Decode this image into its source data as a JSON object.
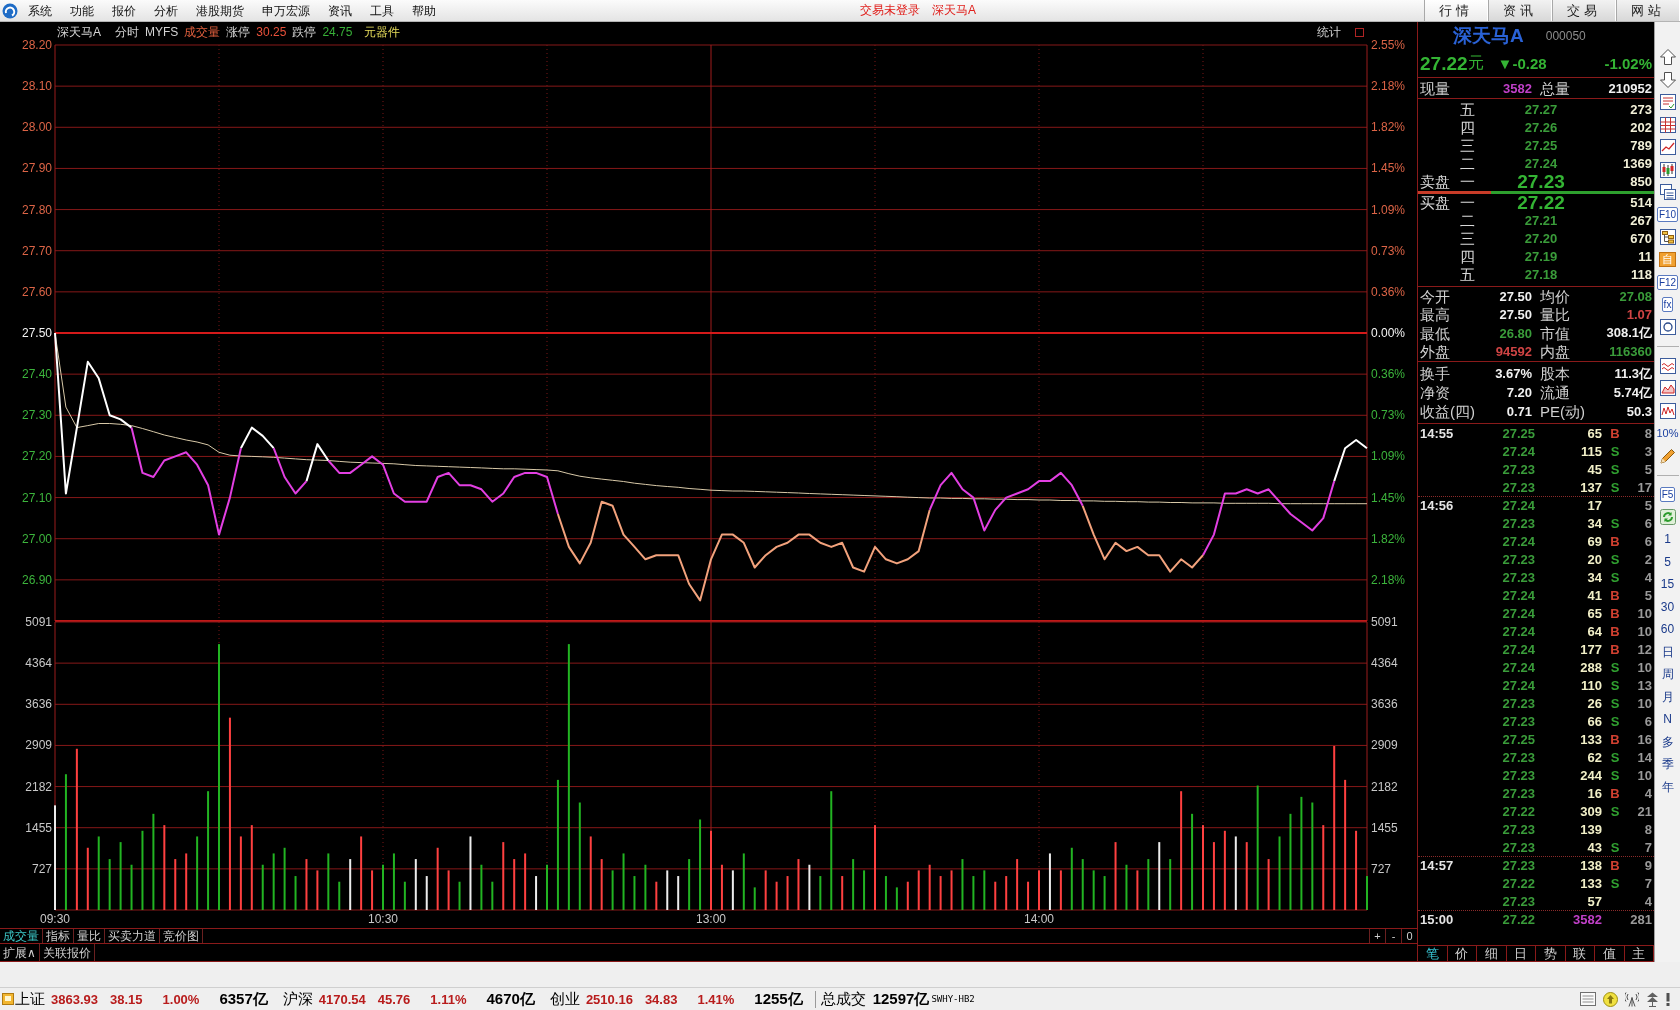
{
  "menu_bar": {
    "items": [
      "系统",
      "功能",
      "报价",
      "分析",
      "港股期货",
      "申万宏源",
      "资讯",
      "工具",
      "帮助"
    ],
    "login_status": "交易未登录",
    "stock_name": "深天马A",
    "tabs": [
      {
        "label": "行情",
        "selected": true
      },
      {
        "label": "资讯",
        "selected": false
      },
      {
        "label": "交易",
        "selected": false
      },
      {
        "label": "网站",
        "selected": false
      }
    ]
  },
  "chart_header": {
    "stock_name": "深天马A",
    "mode": "分时",
    "indicator": "MYFS",
    "volume_label": "成交量",
    "limit_up_label": "涨停",
    "limit_up": "30.25",
    "limit_down_label": "跌停",
    "limit_down": "24.75",
    "industry": "元器件",
    "stats_button": "统计"
  },
  "price_chart": {
    "chart_data": {
      "type": "line",
      "grid": true,
      "categories": [
        null,
        null,
        null,
        null,
        null,
        null,
        null,
        null,
        null,
        null,
        null,
        null,
        null,
        null,
        null,
        null,
        null,
        null,
        null,
        null,
        null,
        null,
        null,
        null,
        null,
        null,
        null,
        null,
        null,
        null,
        null,
        null,
        null,
        null,
        null,
        null,
        null,
        null,
        null,
        null,
        null,
        null,
        null,
        null,
        null,
        null,
        null,
        null,
        null,
        null,
        null,
        null,
        null,
        null,
        null,
        null,
        null,
        null,
        null,
        null,
        null,
        null,
        null,
        null,
        null,
        null,
        null,
        null,
        null,
        null,
        null,
        null,
        null,
        null,
        null,
        null,
        null,
        null,
        null,
        null,
        null,
        null,
        null,
        null,
        null,
        null,
        null,
        null,
        null,
        null,
        null,
        null,
        null,
        null,
        null,
        null,
        null,
        null,
        null,
        null,
        null,
        null,
        null,
        null,
        null,
        null,
        null,
        null,
        null,
        null,
        null,
        null,
        null,
        null,
        null,
        null,
        null,
        null,
        null,
        null,
        null
      ],
      "ylim": [
        26.8,
        28.2
      ],
      "yticks": [
        {
          "value": 28.2,
          "label": "28.20"
        },
        {
          "value": 28.1,
          "label": "28.10"
        },
        {
          "value": 28.0,
          "label": "28.00"
        },
        {
          "value": 27.9,
          "label": "27.90"
        },
        {
          "value": 27.8,
          "label": "27.80"
        },
        {
          "value": 27.7,
          "label": "27.70"
        },
        {
          "value": 27.6,
          "label": "27.60"
        },
        {
          "value": 27.5,
          "label": "27.50"
        },
        {
          "value": 27.4,
          "label": "27.40"
        },
        {
          "value": 27.3,
          "label": "27.30"
        },
        {
          "value": 27.2,
          "label": "27.20"
        },
        {
          "value": 27.1,
          "label": "27.10"
        },
        {
          "value": 27.0,
          "label": "27.00"
        },
        {
          "value": 26.9,
          "label": "26.90"
        }
      ],
      "series": [
        {
          "color": "#d8c9a8",
          "values": [
            27.5,
            27.32,
            27.27,
            27.275,
            27.28,
            27.28,
            27.278,
            27.275,
            27.268,
            27.26,
            27.252,
            27.246,
            27.24,
            27.235,
            27.228,
            27.21,
            27.203,
            27.201,
            27.2,
            27.199,
            27.198,
            27.196,
            27.194,
            27.192,
            27.191,
            27.19,
            27.188,
            27.186,
            27.185,
            27.184,
            27.183,
            27.182,
            27.18,
            27.178,
            27.177,
            27.176,
            27.175,
            27.174,
            27.173,
            27.172,
            27.171,
            27.17,
            27.17,
            27.169,
            27.168,
            27.167,
            27.165,
            27.158,
            27.152,
            27.148,
            27.145,
            27.142,
            27.139,
            27.135,
            27.132,
            27.129,
            27.127,
            27.125,
            27.122,
            27.12,
            27.118,
            27.117,
            27.116,
            27.116,
            27.115,
            27.114,
            27.113,
            27.112,
            27.111,
            27.11,
            27.109,
            27.108,
            27.107,
            27.106,
            27.105,
            27.104,
            27.103,
            27.102,
            27.101,
            27.1,
            27.099,
            27.099,
            27.098,
            27.098,
            27.097,
            27.097,
            27.096,
            27.096,
            27.095,
            27.095,
            27.094,
            27.094,
            27.093,
            27.093,
            27.092,
            27.092,
            27.091,
            27.091,
            27.09,
            27.09,
            27.089,
            27.089,
            27.088,
            27.088,
            27.087,
            27.087,
            27.087,
            27.086,
            27.086,
            27.086,
            27.086,
            27.086,
            27.085,
            27.085,
            27.085,
            27.085,
            27.085,
            27.085,
            27.085,
            27.085,
            27.085
          ]
        },
        {
          "color": "#d41a1a",
          "values": [
            27.5,
            27.5,
            27.5,
            27.5,
            27.5,
            27.5,
            27.5,
            27.5,
            27.5,
            27.5,
            27.5,
            27.5,
            27.5,
            27.5,
            27.5,
            27.5,
            27.5,
            27.5,
            27.5,
            27.5,
            27.5,
            27.5,
            27.5,
            27.5,
            27.5,
            27.5,
            27.5,
            27.5,
            27.5,
            27.5,
            27.5,
            27.5,
            27.5,
            27.5,
            27.5,
            27.5,
            27.5,
            27.5,
            27.5,
            27.5,
            27.5,
            27.5,
            27.5,
            27.5,
            27.5,
            27.5,
            27.5,
            27.5,
            27.5,
            27.5,
            27.5,
            27.5,
            27.5,
            27.5,
            27.5,
            27.5,
            27.5,
            27.5,
            27.5,
            27.5,
            27.5,
            27.5,
            27.5,
            27.5,
            27.5,
            27.5,
            27.5,
            27.5,
            27.5,
            27.5,
            27.5,
            27.5,
            27.5,
            27.5,
            27.5,
            27.5,
            27.5,
            27.5,
            27.5,
            27.5,
            27.5,
            27.5,
            27.5,
            27.5,
            27.5,
            27.5,
            27.5,
            27.5,
            27.5,
            27.5,
            27.5,
            27.5,
            27.5,
            27.5,
            27.5,
            27.5,
            27.5,
            27.5,
            27.5,
            27.5,
            27.5,
            27.5,
            27.5,
            27.5,
            27.5,
            27.5,
            27.5,
            27.5,
            27.5,
            27.5,
            27.5,
            27.5,
            27.5,
            27.5,
            27.5,
            27.5,
            27.5,
            27.5,
            27.5,
            27.5,
            27.5
          ]
        },
        {
          "color": "#ffffff",
          "values": [
            27.5,
            27.11,
            27.27,
            27.43,
            27.39,
            27.3,
            27.29,
            27.27,
            null,
            null,
            null,
            null,
            null,
            null,
            null,
            null,
            null,
            27.22,
            27.27,
            27.25,
            27.22,
            null,
            null,
            27.14,
            27.23,
            27.19,
            null,
            null,
            null,
            null,
            null,
            null,
            null,
            null,
            null,
            null,
            null,
            null,
            null,
            null,
            null,
            null,
            null,
            null,
            null,
            null,
            null,
            null,
            null,
            null,
            null,
            null,
            null,
            null,
            null,
            null,
            null,
            null,
            null,
            null,
            null,
            null,
            null,
            null,
            null,
            null,
            null,
            null,
            null,
            null,
            null,
            null,
            null,
            null,
            null,
            null,
            null,
            null,
            null,
            null,
            null,
            null,
            null,
            null,
            null,
            null,
            null,
            null,
            null,
            null,
            null,
            null,
            null,
            null,
            null,
            null,
            null,
            null,
            null,
            null,
            null,
            null,
            null,
            null,
            null,
            null,
            null,
            null,
            null,
            null,
            null,
            null,
            null,
            null,
            null,
            null,
            null,
            27.14,
            27.22,
            27.24,
            27.22
          ]
        },
        {
          "color": "#e23fe2",
          "values": [
            null,
            null,
            null,
            null,
            null,
            null,
            null,
            27.27,
            27.16,
            27.15,
            27.19,
            27.2,
            27.21,
            27.18,
            27.13,
            27.01,
            27.1,
            27.22,
            null,
            null,
            27.22,
            27.15,
            27.11,
            27.14,
            null,
            27.19,
            27.16,
            27.16,
            27.18,
            27.2,
            27.18,
            27.11,
            27.09,
            27.09,
            27.09,
            27.15,
            27.16,
            27.13,
            27.13,
            27.12,
            27.09,
            27.11,
            27.15,
            27.16,
            27.16,
            27.15,
            27.06,
            null,
            null,
            null,
            null,
            null,
            null,
            null,
            null,
            null,
            null,
            null,
            null,
            null,
            null,
            null,
            null,
            null,
            null,
            null,
            null,
            null,
            null,
            null,
            null,
            null,
            null,
            null,
            null,
            null,
            null,
            null,
            null,
            null,
            27.07,
            27.13,
            27.16,
            27.12,
            27.1,
            27.02,
            27.07,
            27.1,
            27.11,
            27.12,
            27.14,
            27.14,
            27.16,
            27.13,
            27.08,
            null,
            null,
            null,
            null,
            null,
            null,
            null,
            null,
            null,
            null,
            26.96,
            27.01,
            27.11,
            27.11,
            27.12,
            27.11,
            27.12,
            27.09,
            27.06,
            27.04,
            27.02,
            27.05,
            27.14,
            null,
            null,
            null
          ]
        },
        {
          "color": "#f2a27c",
          "values": [
            null,
            null,
            null,
            null,
            null,
            null,
            null,
            null,
            null,
            null,
            null,
            null,
            null,
            null,
            null,
            null,
            null,
            null,
            null,
            null,
            null,
            null,
            null,
            null,
            null,
            null,
            null,
            null,
            null,
            null,
            null,
            null,
            null,
            null,
            null,
            null,
            null,
            null,
            null,
            null,
            null,
            null,
            null,
            null,
            null,
            null,
            27.06,
            26.98,
            26.94,
            26.99,
            27.09,
            27.08,
            27.01,
            26.98,
            26.95,
            26.96,
            26.96,
            26.96,
            26.89,
            26.85,
            26.95,
            27.01,
            27.01,
            26.99,
            26.93,
            26.96,
            26.98,
            26.99,
            27.01,
            27.01,
            26.99,
            26.98,
            26.99,
            26.93,
            26.92,
            26.98,
            26.95,
            26.94,
            26.95,
            26.97,
            27.07,
            null,
            null,
            null,
            null,
            null,
            null,
            null,
            null,
            null,
            null,
            null,
            null,
            null,
            27.08,
            27.01,
            26.95,
            26.99,
            26.97,
            26.98,
            26.96,
            26.96,
            26.92,
            26.95,
            26.93,
            26.96,
            null,
            null,
            null,
            null,
            null,
            null,
            null,
            null,
            null,
            null,
            null,
            null,
            null,
            null,
            null
          ]
        }
      ]
    },
    "right_labels": [
      "2.55%",
      "2.18%",
      "1.82%",
      "1.45%",
      "1.09%",
      "0.73%",
      "0.36%",
      "0.00%",
      "0.36%",
      "0.73%",
      "1.09%",
      "1.45%",
      "1.82%",
      "2.18%"
    ]
  },
  "volume_chart": {
    "chart_data": {
      "type": "bar",
      "grid": true,
      "categories": [
        "09:30",
        null,
        null,
        null,
        null,
        null,
        null,
        null,
        null,
        null,
        null,
        null,
        null,
        null,
        null,
        null,
        null,
        null,
        null,
        null,
        null,
        null,
        null,
        null,
        null,
        null,
        null,
        null,
        null,
        null,
        "10:30",
        null,
        null,
        null,
        null,
        null,
        null,
        null,
        null,
        null,
        null,
        null,
        null,
        null,
        null,
        null,
        null,
        null,
        null,
        null,
        null,
        null,
        null,
        null,
        null,
        null,
        null,
        null,
        null,
        null,
        "13:00",
        null,
        null,
        null,
        null,
        null,
        null,
        null,
        null,
        null,
        null,
        null,
        null,
        null,
        null,
        null,
        null,
        null,
        null,
        null,
        null,
        null,
        null,
        null,
        null,
        null,
        null,
        null,
        null,
        null,
        "14:00",
        null,
        null,
        null,
        null,
        null,
        null,
        null,
        null,
        null,
        null,
        null,
        null,
        null,
        null,
        null,
        null,
        null,
        null,
        null,
        null,
        null,
        null,
        null,
        null,
        null,
        null,
        null,
        null,
        null,
        null
      ],
      "ylim": [
        0,
        5091
      ],
      "yticks": [
        5091,
        4364,
        3636,
        2909,
        2182,
        1455,
        727
      ],
      "series": [
        {
          "values": [
            1850,
            2400,
            2850,
            1100,
            1300,
            900,
            1200,
            800,
            1400,
            1700,
            1500,
            900,
            1000,
            1300,
            2100,
            4700,
            3400,
            1300,
            1500,
            800,
            1000,
            1100,
            600,
            900,
            700,
            1000,
            500,
            900,
            1300,
            700,
            800,
            1000,
            500,
            900,
            600,
            1100,
            700,
            500,
            1300,
            800,
            500,
            1200,
            900,
            1000,
            600,
            800,
            2300,
            4700,
            1900,
            1300,
            900,
            700,
            1000,
            600,
            800,
            500,
            700,
            600,
            900,
            1600,
            1400,
            800,
            700,
            1000,
            400,
            700,
            500,
            600,
            900,
            800,
            600,
            2100,
            600,
            900,
            700,
            1500,
            600,
            400,
            500,
            700,
            800,
            600,
            700,
            900,
            600,
            700,
            500,
            600,
            900,
            500,
            700,
            1000,
            700,
            1100,
            900,
            700,
            600,
            1200,
            800,
            700,
            900,
            1200,
            900,
            2100,
            1700,
            1500,
            1200,
            1400,
            1300,
            1200,
            2200,
            900,
            1300,
            1700,
            2000,
            1900,
            1500,
            2900,
            2300,
            1400,
            600
          ]
        }
      ]
    },
    "right_labels": [
      "5091",
      "4364",
      "3636",
      "2909",
      "2182",
      "1455",
      "727"
    ]
  },
  "chart_tabs": [
    {
      "label": "成交量",
      "selected": true
    },
    {
      "label": "指标",
      "selected": false
    },
    {
      "label": "量比",
      "selected": false
    },
    {
      "label": "买卖力道",
      "selected": false
    },
    {
      "label": "竞价图",
      "selected": false
    }
  ],
  "zoom_controls": [
    "+",
    "-",
    "0"
  ],
  "extra_tabs": [
    "扩展∧",
    "关联报价"
  ],
  "quote_panel": {
    "name": "深天马A",
    "code": "000050",
    "price": "27.22",
    "unit": "元",
    "change": "▼-0.28",
    "percent": "-1.02%",
    "current_volume_label": "现量",
    "current_volume": "3582",
    "total_volume_label": "总量",
    "total_volume": "210952",
    "asks_label": "卖盘",
    "asks": [
      {
        "rank": "五",
        "price": "27.27",
        "volume": "273"
      },
      {
        "rank": "四",
        "price": "27.26",
        "volume": "202"
      },
      {
        "rank": "三",
        "price": "27.25",
        "volume": "789"
      },
      {
        "rank": "二",
        "price": "27.24",
        "volume": "1369"
      },
      {
        "rank": "一",
        "price": "27.23",
        "volume": "850"
      }
    ],
    "order_balance": {
      "level": 0.31
    },
    "bids_label": "买盘",
    "bids": [
      {
        "rank": "一",
        "price": "27.22",
        "volume": "514"
      },
      {
        "rank": "二",
        "price": "27.21",
        "volume": "267"
      },
      {
        "rank": "三",
        "price": "27.20",
        "volume": "670"
      },
      {
        "rank": "四",
        "price": "27.19",
        "volume": "11"
      },
      {
        "rank": "五",
        "price": "27.18",
        "volume": "118"
      }
    ],
    "stat_groups": [
      {
        "items": [
          {
            "label": "今开",
            "value": "27.50",
            "color": "#f0f0f0"
          },
          {
            "label": "均价",
            "value": "27.08",
            "color": "#3a9c3a"
          },
          {
            "label": "最高",
            "value": "27.50",
            "color": "#f0f0f0"
          },
          {
            "label": "量比",
            "value": "1.07",
            "color": "#d04444"
          },
          {
            "label": "最低",
            "value": "26.80",
            "color": "#3a9c3a"
          },
          {
            "label": "市值",
            "value": "308.1亿",
            "color": "#f0f0f0"
          },
          {
            "label": "外盘",
            "value": "94592",
            "color": "#d04444"
          },
          {
            "label": "内盘",
            "value": "116360",
            "color": "#3a9c3a"
          }
        ]
      },
      {
        "items": [
          {
            "label": "换手",
            "value": "3.67%",
            "color": "#f0f0f0"
          },
          {
            "label": "股本",
            "value": "11.3亿",
            "color": "#f0f0f0"
          },
          {
            "label": "净资",
            "value": "7.20",
            "color": "#f0f0f0"
          },
          {
            "label": "流通",
            "value": "5.74亿",
            "color": "#f0f0f0"
          },
          {
            "label": "收益(四)",
            "value": "0.71",
            "color": "#f0f0f0"
          },
          {
            "label": "PE(动)",
            "value": "50.3",
            "color": "#f0f0f0"
          }
        ]
      }
    ],
    "ticks": [
      {
        "time": "14:55",
        "kind": "trade",
        "rows": [
          {
            "price": "27.25",
            "volume": "65",
            "flag": "B",
            "color": "#d04030",
            "count": "8"
          },
          {
            "price": "27.24",
            "volume": "115",
            "flag": "S",
            "color": "#30a030",
            "count": "3"
          },
          {
            "price": "27.23",
            "volume": "45",
            "flag": "S",
            "color": "#30a030",
            "count": "5"
          },
          {
            "price": "27.23",
            "volume": "137",
            "flag": "S",
            "color": "#30a030",
            "count": "17"
          }
        ]
      },
      {
        "time": "14:56",
        "kind": "trade",
        "rows": [
          {
            "price": "27.24",
            "volume": "17",
            "count": "5"
          },
          {
            "price": "27.23",
            "volume": "34",
            "flag": "S",
            "color": "#30a030",
            "count": "6"
          },
          {
            "price": "27.24",
            "volume": "69",
            "flag": "B",
            "color": "#d04030",
            "count": "6"
          },
          {
            "price": "27.23",
            "volume": "20",
            "flag": "S",
            "color": "#30a030",
            "count": "2"
          },
          {
            "price": "27.23",
            "volume": "34",
            "flag": "S",
            "color": "#30a030",
            "count": "4"
          },
          {
            "price": "27.24",
            "volume": "41",
            "flag": "B",
            "color": "#d04030",
            "count": "5"
          },
          {
            "price": "27.24",
            "volume": "65",
            "flag": "B",
            "color": "#d04030",
            "count": "10"
          },
          {
            "price": "27.24",
            "volume": "64",
            "flag": "B",
            "color": "#d04030",
            "count": "10"
          },
          {
            "price": "27.24",
            "volume": "177",
            "flag": "B",
            "color": "#d04030",
            "count": "12"
          },
          {
            "price": "27.24",
            "volume": "288",
            "flag": "S",
            "color": "#30a030",
            "count": "10"
          },
          {
            "price": "27.24",
            "volume": "110",
            "flag": "S",
            "color": "#30a030",
            "count": "13"
          },
          {
            "price": "27.23",
            "volume": "26",
            "flag": "S",
            "color": "#30a030",
            "count": "10"
          },
          {
            "price": "27.23",
            "volume": "66",
            "flag": "S",
            "color": "#30a030",
            "count": "6"
          },
          {
            "price": "27.25",
            "volume": "133",
            "flag": "B",
            "color": "#d04030",
            "count": "16"
          },
          {
            "price": "27.23",
            "volume": "62",
            "flag": "S",
            "color": "#30a030",
            "count": "14"
          },
          {
            "price": "27.23",
            "volume": "244",
            "flag": "S",
            "color": "#30a030",
            "count": "10"
          },
          {
            "price": "27.23",
            "volume": "16",
            "flag": "B",
            "color": "#d04030",
            "count": "4"
          },
          {
            "price": "27.22",
            "volume": "309",
            "flag": "S",
            "color": "#30a030",
            "count": "21"
          },
          {
            "price": "27.23",
            "volume": "139",
            "count": "8"
          },
          {
            "price": "27.23",
            "volume": "43",
            "flag": "S",
            "color": "#30a030",
            "count": "7"
          }
        ]
      },
      {
        "time": "14:57",
        "kind": "trade",
        "rows": [
          {
            "price": "27.23",
            "volume": "138",
            "flag": "B",
            "color": "#d04030",
            "count": "9"
          },
          {
            "price": "27.22",
            "volume": "133",
            "flag": "S",
            "color": "#30a030",
            "count": "7"
          },
          {
            "price": "27.23",
            "volume": "57",
            "count": "4"
          }
        ]
      },
      {
        "time": "15:00",
        "kind": "auction",
        "rows": [
          {
            "price": "27.22",
            "volume": "3582",
            "count": "281"
          }
        ]
      }
    ],
    "panel_tabs": [
      {
        "label": "笔",
        "selected": true
      },
      {
        "label": "价",
        "selected": false
      },
      {
        "label": "细",
        "selected": false
      },
      {
        "label": "日",
        "selected": false
      },
      {
        "label": "势",
        "selected": false
      },
      {
        "label": "联",
        "selected": false
      },
      {
        "label": "值",
        "selected": false
      },
      {
        "label": "主",
        "selected": false
      }
    ]
  },
  "tool_strip": {
    "keys": [
      {
        "label": "F10",
        "kind": "boxed"
      },
      {
        "label": "自",
        "kind": "badge"
      },
      {
        "label": "F12",
        "kind": "boxed"
      },
      {
        "label": "fx",
        "kind": "boxed"
      },
      {
        "label": "10%",
        "kind": "plain"
      },
      {
        "label": "F5",
        "kind": "boxed"
      }
    ],
    "periods": [
      "1",
      "5",
      "15",
      "30",
      "60",
      "日",
      "周",
      "月",
      "N",
      "多",
      "季",
      "年"
    ]
  },
  "status_bar": {
    "indices": [
      {
        "name": "上证",
        "value": "3863.93",
        "change": "38.15",
        "percent": "1.00%",
        "amount": "6357亿"
      },
      {
        "name": "沪深",
        "value": "4170.54",
        "change": "45.76",
        "percent": "1.11%",
        "amount": "4670亿"
      },
      {
        "name": "创业",
        "value": "2510.16",
        "change": "34.83",
        "percent": "1.41%",
        "amount": "1255亿"
      }
    ],
    "total_label": "总成交",
    "total": "12597亿",
    "server": "SWHY-HB2"
  }
}
